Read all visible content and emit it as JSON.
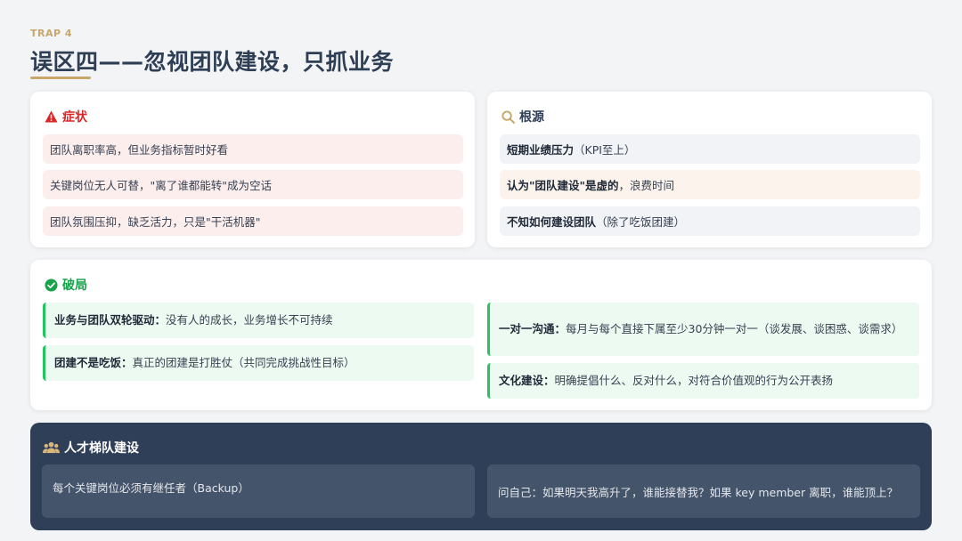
{
  "header": {
    "trap_label": "TRAP 4",
    "title": "误区四——忽视团队建设，只抓业务"
  },
  "symptoms": {
    "icon": "warning-icon",
    "title": "症状",
    "items": [
      "团队离职率高，但业务指标暂时好看",
      "关键岗位无人可替，\"离了谁都能转\"成为空话",
      "团队氛围压抑，缺乏活力，只是\"干活机器\""
    ]
  },
  "root_cause": {
    "icon": "search-icon",
    "title": "根源",
    "items": [
      {
        "bold": "短期业绩压力",
        "rest": "（KPI至上）"
      },
      {
        "bold": "认为\"团队建设\"是虚的",
        "rest": "，浪费时间"
      },
      {
        "bold": "不知如何建设团队",
        "rest": "（除了吃饭团建）"
      }
    ]
  },
  "breakthrough": {
    "icon": "check-circle-icon",
    "title": "破局",
    "items": [
      {
        "bold": "业务与团队双轮驱动：",
        "rest": "没有人的成长，业务增长不可持续"
      },
      {
        "bold": "团建不是吃饭：",
        "rest": "真正的团建是打胜仗（共同完成挑战性目标）"
      },
      {
        "bold": "一对一沟通：",
        "rest": "每月与每个直接下属至少30分钟一对一（谈发展、谈困惑、谈需求）"
      },
      {
        "bold": "文化建设：",
        "rest": "明确提倡什么、反对什么，对符合价值观的行为公开表扬"
      }
    ]
  },
  "talent": {
    "icon": "users-icon",
    "title": "人才梯队建设",
    "left": "每个关键岗位必须有继任者（Backup）",
    "right": "问自己：如果明天我高升了，谁能接替我？如果 key member 离职，谁能顶上？"
  },
  "colors": {
    "accent_gold": "#c9a76a",
    "title_navy": "#2d3e55",
    "danger_red": "#dc2626",
    "success_green": "#16a34a",
    "dark_panel": "#2f3f57"
  }
}
